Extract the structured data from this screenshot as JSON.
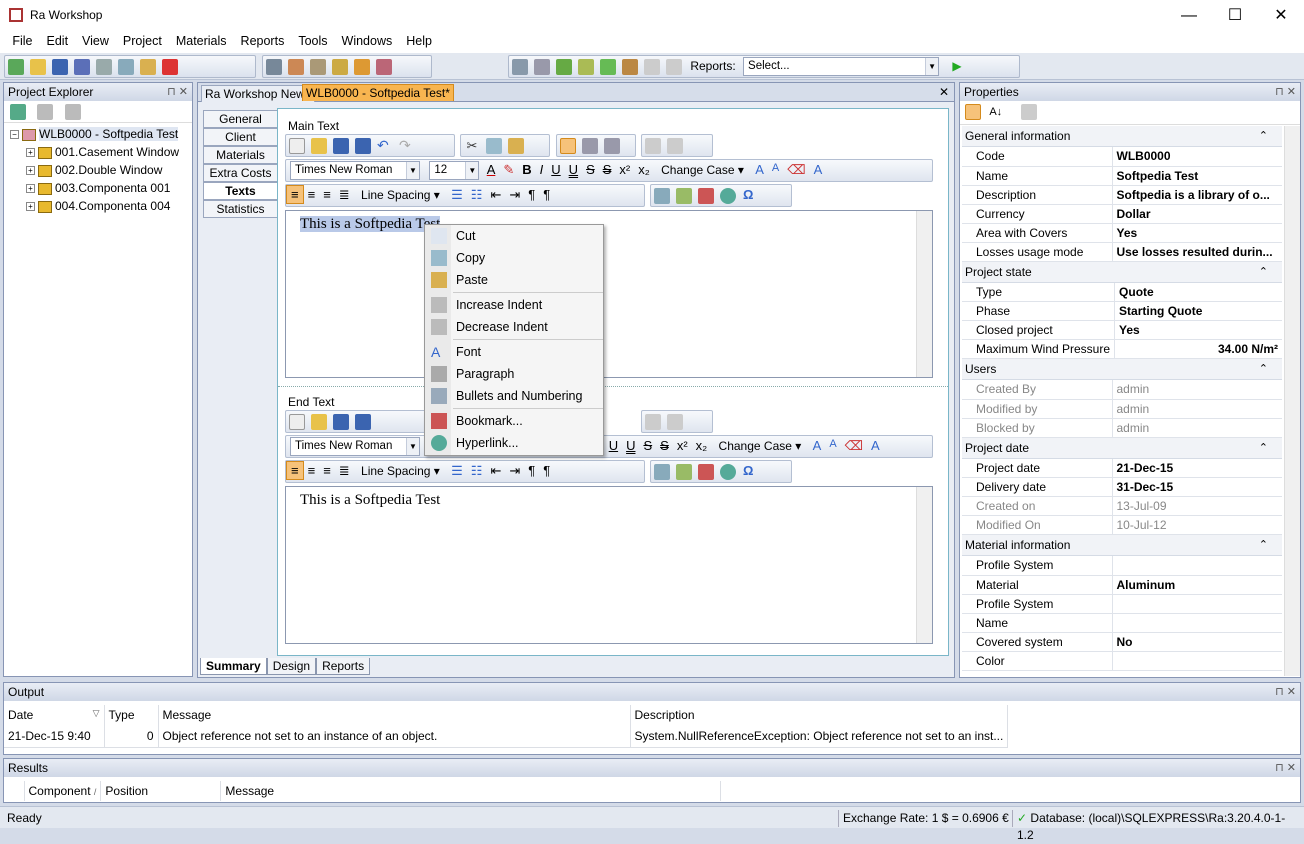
{
  "window": {
    "title": "Ra Workshop",
    "buttons": [
      "—",
      "☐",
      "✕"
    ]
  },
  "menu": [
    "File",
    "Edit",
    "View",
    "Project",
    "Materials",
    "Reports",
    "Tools",
    "Windows",
    "Help"
  ],
  "toolbar": {
    "reports_label": "Reports:",
    "reports_select": "Select..."
  },
  "explorer": {
    "title": "Project Explorer",
    "root": "WLB0000 - Softpedia Test",
    "children": [
      "001.Casement Window",
      "002.Double Window",
      "003.Componenta 001",
      "004.Componenta 004"
    ]
  },
  "doc_tabs": [
    {
      "label": "Ra Workshop News"
    },
    {
      "label": "WLB0000 - Softpedia Test*"
    }
  ],
  "side_tabs": [
    "General",
    "Client",
    "Materials",
    "Extra Costs",
    "Texts",
    "Statistics"
  ],
  "main_text": {
    "label": "Main Text",
    "font": "Times New Roman",
    "size": "12",
    "change_case": "Change Case",
    "line_spacing": "Line Spacing",
    "content": "This is a Softpedia Test"
  },
  "end_text": {
    "label": "End Text",
    "font": "Times New Roman",
    "change_case": "Change Case",
    "line_spacing": "Line Spacing",
    "content": "This is a Softpedia Test"
  },
  "context_menu": {
    "groups": [
      [
        {
          "label": "Cut",
          "icon": "scissors-icon"
        },
        {
          "label": "Copy",
          "icon": "copy-icon"
        },
        {
          "label": "Paste",
          "icon": "paste-icon"
        }
      ],
      [
        {
          "label": "Increase Indent",
          "icon": "increase-indent-icon"
        },
        {
          "label": "Decrease Indent",
          "icon": "decrease-indent-icon"
        }
      ],
      [
        {
          "label": "Font",
          "icon": "font-icon"
        },
        {
          "label": "Paragraph",
          "icon": "paragraph-icon"
        },
        {
          "label": "Bullets and Numbering",
          "icon": "bullets-icon"
        }
      ],
      [
        {
          "label": "Bookmark...",
          "icon": "bookmark-icon"
        },
        {
          "label": "Hyperlink...",
          "icon": "hyperlink-icon"
        }
      ]
    ]
  },
  "bottom_tabs": [
    "Summary",
    "Design",
    "Reports"
  ],
  "properties": {
    "title": "Properties",
    "categories": [
      {
        "name": "General information",
        "rows": [
          {
            "k": "Code",
            "v": "WLB0000"
          },
          {
            "k": "Name",
            "v": "Softpedia Test"
          },
          {
            "k": "Description",
            "v": "Softpedia is a library of o..."
          },
          {
            "k": "Currency",
            "v": "Dollar"
          },
          {
            "k": "Area with Covers",
            "v": "Yes"
          },
          {
            "k": "Losses usage mode",
            "v": "Use losses resulted durin..."
          }
        ]
      },
      {
        "name": "Project state",
        "rows": [
          {
            "k": "Type",
            "v": "Quote"
          },
          {
            "k": "Phase",
            "v": "Starting Quote"
          },
          {
            "k": "Closed project",
            "v": "Yes"
          },
          {
            "k": "Maximum Wind Pressure",
            "v": "34.00 N/m²"
          }
        ]
      },
      {
        "name": "Users",
        "rows": [
          {
            "k": "Created By",
            "v": "admin"
          },
          {
            "k": "Modified by",
            "v": "admin"
          },
          {
            "k": "Blocked by",
            "v": "admin"
          }
        ]
      },
      {
        "name": "Project date",
        "rows": [
          {
            "k": "Project date",
            "v": "21-Dec-15"
          },
          {
            "k": "Delivery date",
            "v": "31-Dec-15"
          },
          {
            "k": "Created on",
            "v": "13-Jul-09"
          },
          {
            "k": "Modified On",
            "v": "10-Jul-12"
          }
        ]
      },
      {
        "name": "Material information",
        "rows": [
          {
            "k": "Profile System",
            "v": ""
          },
          {
            "k": "Material",
            "v": "Aluminum"
          },
          {
            "k": "Profile System",
            "v": ""
          },
          {
            "k": "Name",
            "v": ""
          },
          {
            "k": "Covered system",
            "v": "No"
          },
          {
            "k": "Color",
            "v": ""
          }
        ]
      }
    ]
  },
  "output": {
    "title": "Output",
    "columns": [
      "Date",
      "Type",
      "Message",
      "Description"
    ],
    "rows": [
      [
        "21-Dec-15 9:40",
        "0",
        "Object reference not set to an instance of an object.",
        "System.NullReferenceException: Object reference not set to an inst..."
      ]
    ]
  },
  "results": {
    "title": "Results",
    "columns": [
      "Component",
      "Position",
      "Message"
    ]
  },
  "status": {
    "left": "Ready",
    "exchange": "Exchange Rate: 1 $ = 0.6906 €",
    "database": "Database: (local)\\SQLEXPRESS\\Ra:3.20.4.0-1-1.2"
  }
}
